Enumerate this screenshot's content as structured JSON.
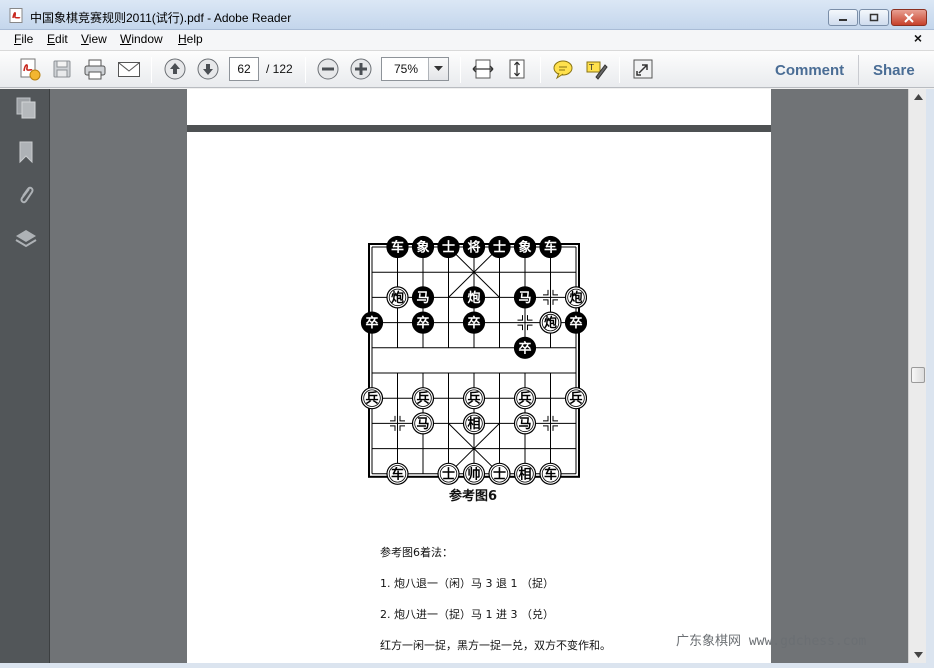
{
  "window": {
    "title": "中国象棋竞赛规则2011(试行).pdf - Adobe Reader"
  },
  "menu": {
    "items": [
      {
        "label": "File",
        "key": "F",
        "rest": "ile"
      },
      {
        "label": "Edit",
        "key": "E",
        "rest": "dit"
      },
      {
        "label": "View",
        "key": "V",
        "rest": "iew"
      },
      {
        "label": "Window",
        "key": "W",
        "rest": "indow"
      },
      {
        "label": "Help",
        "key": "H",
        "rest": "elp"
      }
    ],
    "close_doc": "×"
  },
  "toolbar": {
    "page_current": "62",
    "page_total": "/ 122",
    "zoom": "75%",
    "comment_label": "Comment",
    "share_label": "Share"
  },
  "document": {
    "board_caption": "参考图6",
    "lines": [
      "参考图6着法：",
      "1. 炮八退一（闲）马 3 退 1 （捉）",
      "2. 炮八进一（捉）马 1 进 3 （兑）",
      "红方一闲一捉，黑方一捉一兑，双方不变作和。"
    ],
    "board": {
      "black_pieces": [
        {
          "char": "车",
          "col": 1,
          "row": 0
        },
        {
          "char": "象",
          "col": 2,
          "row": 0
        },
        {
          "char": "士",
          "col": 3,
          "row": 0
        },
        {
          "char": "将",
          "col": 4,
          "row": 0
        },
        {
          "char": "士",
          "col": 5,
          "row": 0
        },
        {
          "char": "象",
          "col": 6,
          "row": 0
        },
        {
          "char": "车",
          "col": 7,
          "row": 0
        },
        {
          "char": "马",
          "col": 2,
          "row": 2
        },
        {
          "char": "炮",
          "col": 4,
          "row": 2
        },
        {
          "char": "马",
          "col": 6,
          "row": 2
        },
        {
          "char": "卒",
          "col": 0,
          "row": 3
        },
        {
          "char": "卒",
          "col": 2,
          "row": 3
        },
        {
          "char": "卒",
          "col": 4,
          "row": 3
        },
        {
          "char": "卒",
          "col": 8,
          "row": 3
        },
        {
          "char": "卒",
          "col": 6,
          "row": 4
        }
      ],
      "red_pieces": [
        {
          "char": "炮",
          "col": 1,
          "row": 2
        },
        {
          "char": "炮",
          "col": 8,
          "row": 2
        },
        {
          "char": "炮",
          "col": 7,
          "row": 3
        },
        {
          "char": "兵",
          "col": 0,
          "row": 6
        },
        {
          "char": "兵",
          "col": 2,
          "row": 6
        },
        {
          "char": "兵",
          "col": 4,
          "row": 6
        },
        {
          "char": "兵",
          "col": 6,
          "row": 6
        },
        {
          "char": "兵",
          "col": 8,
          "row": 6
        },
        {
          "char": "马",
          "col": 2,
          "row": 7
        },
        {
          "char": "相",
          "col": 4,
          "row": 7
        },
        {
          "char": "马",
          "col": 6,
          "row": 7
        },
        {
          "char": "车",
          "col": 1,
          "row": 9
        },
        {
          "char": "士",
          "col": 3,
          "row": 9
        },
        {
          "char": "帅",
          "col": 4,
          "row": 9
        },
        {
          "char": "士",
          "col": 5,
          "row": 9
        },
        {
          "char": "相",
          "col": 6,
          "row": 9
        },
        {
          "char": "车",
          "col": 7,
          "row": 9
        }
      ],
      "markers": [
        {
          "col": 7,
          "row": 2
        },
        {
          "col": 6,
          "row": 3
        },
        {
          "col": 1,
          "row": 7
        },
        {
          "col": 7,
          "row": 7
        }
      ]
    }
  },
  "watermark": "广东象棋网 www.gdchess.com",
  "colors": {
    "doc_background": "#707376",
    "nav_pane": "#525659",
    "link_blue": "#4a6d95"
  }
}
